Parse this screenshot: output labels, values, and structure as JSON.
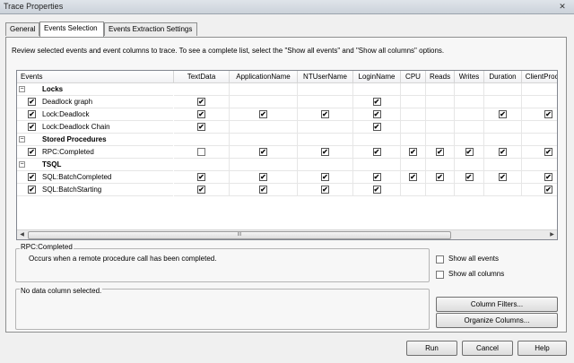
{
  "window": {
    "title": "Trace Properties"
  },
  "tabs": [
    {
      "label": "General"
    },
    {
      "label": "Events Selection"
    },
    {
      "label": "Events Extraction Settings"
    }
  ],
  "instructions": "Review selected events and event columns to trace. To see a complete list, select the \"Show all events\" and \"Show all columns\" options.",
  "grid": {
    "headers": [
      "Events",
      "TextData",
      "ApplicationName",
      "NTUserName",
      "LoginName",
      "CPU",
      "Reads",
      "Writes",
      "Duration",
      "ClientProcessI"
    ],
    "rows": [
      {
        "type": "category",
        "label": "Locks",
        "expander": "−"
      },
      {
        "type": "event",
        "label": "Deadlock graph",
        "checked": true,
        "cells": [
          1,
          0,
          0,
          1,
          0,
          0,
          0,
          0,
          0
        ]
      },
      {
        "type": "event",
        "label": "Lock:Deadlock",
        "checked": true,
        "cells": [
          1,
          1,
          1,
          1,
          0,
          0,
          0,
          1,
          1
        ]
      },
      {
        "type": "event",
        "label": "Lock:Deadlock Chain",
        "checked": true,
        "cells": [
          1,
          0,
          0,
          1,
          0,
          0,
          0,
          0,
          0
        ]
      },
      {
        "type": "category",
        "label": "Stored Procedures",
        "expander": "−"
      },
      {
        "type": "event",
        "label": "RPC:Completed",
        "checked": true,
        "cells": [
          2,
          1,
          1,
          1,
          1,
          1,
          1,
          1,
          1
        ]
      },
      {
        "type": "category",
        "label": "TSQL",
        "expander": "−"
      },
      {
        "type": "event",
        "label": "SQL:BatchCompleted",
        "checked": true,
        "cells": [
          1,
          1,
          1,
          1,
          1,
          1,
          1,
          1,
          1
        ]
      },
      {
        "type": "event",
        "label": "SQL:BatchStarting",
        "checked": true,
        "cells": [
          1,
          1,
          1,
          1,
          0,
          0,
          0,
          0,
          1
        ]
      }
    ],
    "scroll_glyph": "III"
  },
  "description_box": {
    "title": "RPC:Completed",
    "text": "Occurs when a remote procedure call has been completed."
  },
  "column_box": {
    "text": "No data column selected."
  },
  "options": {
    "show_all_events": "Show all events",
    "show_all_columns": "Show all columns"
  },
  "buttons": {
    "column_filters": "Column Filters...",
    "organize_columns": "Organize Columns...",
    "run": "Run",
    "cancel": "Cancel",
    "help": "Help"
  },
  "glyphs": {
    "check": "✔",
    "close": "✕"
  }
}
